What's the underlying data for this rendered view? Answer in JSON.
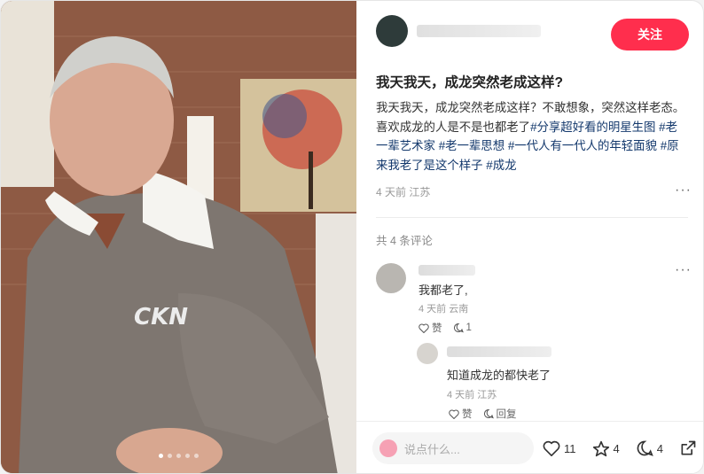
{
  "author": {
    "follow_label": "关注"
  },
  "post": {
    "title": "我天我天，成龙突然老成这样?",
    "body": "我天我天，成龙突然老成这样？不敢想象，突然这样老态。喜欢成龙的人是不是也都老了",
    "tags": [
      "#分享超好看的明星生图",
      "#老一辈艺术家",
      "#老一辈思想",
      "#一代人有一代人的年轻面貌",
      "#原来我老了是这个样子",
      "#成龙"
    ],
    "meta": "4 天前 江苏"
  },
  "comments": {
    "count_label": "共 4 条评论",
    "items": [
      {
        "text": "我都老了,",
        "meta": "4 天前 云南",
        "like": "赞",
        "reply_count": "1"
      },
      {
        "text": "知道成龙的都快老了",
        "meta": "4 天前 江苏",
        "like": "赞",
        "reply": "回复"
      }
    ]
  },
  "bottom_bar": {
    "input_placeholder": "说点什么...",
    "like_count": "11",
    "star_count": "4",
    "comment_count": "4"
  },
  "image": {
    "dots": 5,
    "active_dot": 0,
    "shirt_logo": "CKN"
  },
  "colors": {
    "accent": "#ff2e4d",
    "tag": "#13386c"
  },
  "icons": [
    "more-icon",
    "heart-icon",
    "star-icon",
    "comment-icon",
    "share-icon",
    "mascot-icon"
  ]
}
